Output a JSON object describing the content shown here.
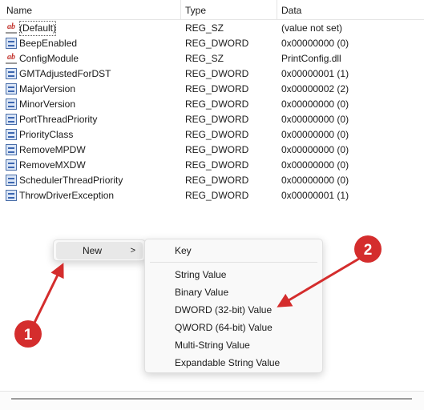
{
  "columns": {
    "name": "Name",
    "type": "Type",
    "data": "Data"
  },
  "rows": [
    {
      "name": "(Default)",
      "type": "REG_SZ",
      "data": "(value not set)",
      "icon": "string-value-icon"
    },
    {
      "name": "BeepEnabled",
      "type": "REG_DWORD",
      "data": "0x00000000 (0)",
      "icon": "binary-value-icon"
    },
    {
      "name": "ConfigModule",
      "type": "REG_SZ",
      "data": "PrintConfig.dll",
      "icon": "string-value-icon"
    },
    {
      "name": "GMTAdjustedForDST",
      "type": "REG_DWORD",
      "data": "0x00000001 (1)",
      "icon": "binary-value-icon"
    },
    {
      "name": "MajorVersion",
      "type": "REG_DWORD",
      "data": "0x00000002 (2)",
      "icon": "binary-value-icon"
    },
    {
      "name": "MinorVersion",
      "type": "REG_DWORD",
      "data": "0x00000000 (0)",
      "icon": "binary-value-icon"
    },
    {
      "name": "PortThreadPriority",
      "type": "REG_DWORD",
      "data": "0x00000000 (0)",
      "icon": "binary-value-icon"
    },
    {
      "name": "PriorityClass",
      "type": "REG_DWORD",
      "data": "0x00000000 (0)",
      "icon": "binary-value-icon"
    },
    {
      "name": "RemoveMPDW",
      "type": "REG_DWORD",
      "data": "0x00000000 (0)",
      "icon": "binary-value-icon"
    },
    {
      "name": "RemoveMXDW",
      "type": "REG_DWORD",
      "data": "0x00000000 (0)",
      "icon": "binary-value-icon"
    },
    {
      "name": "SchedulerThreadPriority",
      "type": "REG_DWORD",
      "data": "0x00000000 (0)",
      "icon": "binary-value-icon"
    },
    {
      "name": "ThrowDriverException",
      "type": "REG_DWORD",
      "data": "0x00000001 (1)",
      "icon": "binary-value-icon"
    }
  ],
  "context_menu": {
    "new_label": "New",
    "arrow": ">"
  },
  "submenu": {
    "items": [
      "Key",
      "String Value",
      "Binary Value",
      "DWORD (32-bit) Value",
      "QWORD (64-bit) Value",
      "Multi-String Value",
      "Expandable String Value"
    ]
  },
  "annotations": {
    "marker_1": "1",
    "marker_2": "2",
    "color": "#d42d2d"
  }
}
